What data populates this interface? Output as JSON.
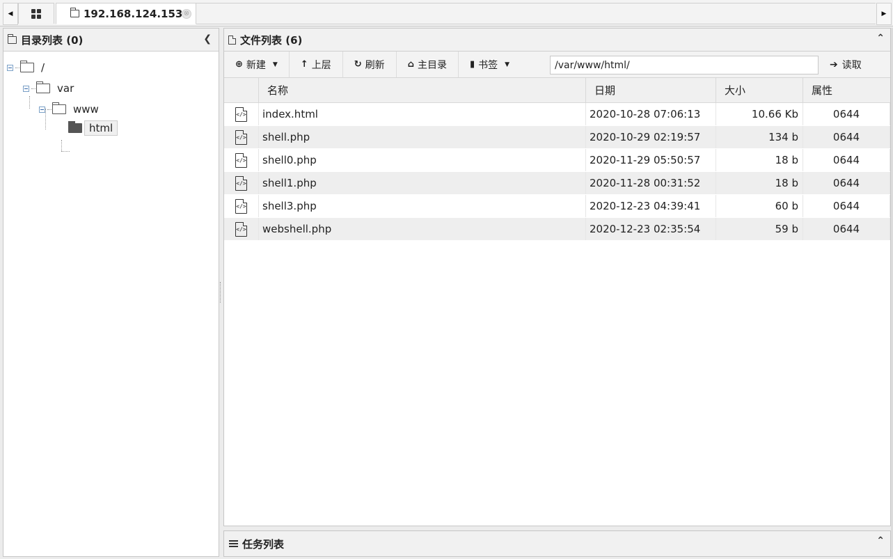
{
  "tabs": {
    "active_label": "192.168.124.153",
    "close_symbol": "⊗",
    "scroll_left": "◀",
    "scroll_right": "▶"
  },
  "left_panel": {
    "title": "目录列表 (0)",
    "collapse_symbol": "❮",
    "tree": [
      {
        "label": "/",
        "state": "expanded"
      },
      {
        "label": "var",
        "state": "expanded"
      },
      {
        "label": "www",
        "state": "expanded"
      },
      {
        "label": "html",
        "state": "selected"
      }
    ]
  },
  "right_panel": {
    "title": "文件列表 (6)",
    "expand_symbol": "⌃",
    "toolbar": {
      "new_label": "新建",
      "up_label": "上层",
      "refresh_label": "刷新",
      "home_label": "主目录",
      "bookmark_label": "书签",
      "path_value": "/var/www/html/",
      "read_label": "读取"
    },
    "columns": [
      "名称",
      "日期",
      "大小",
      "属性"
    ],
    "files": [
      {
        "name": "index.html",
        "date": "2020-10-28 07:06:13",
        "size": "10.66 Kb",
        "perm": "0644"
      },
      {
        "name": "shell.php",
        "date": "2020-10-29 02:19:57",
        "size": "134 b",
        "perm": "0644"
      },
      {
        "name": "shell0.php",
        "date": "2020-11-29 05:50:57",
        "size": "18 b",
        "perm": "0644"
      },
      {
        "name": "shell1.php",
        "date": "2020-11-28 00:31:52",
        "size": "18 b",
        "perm": "0644"
      },
      {
        "name": "shell3.php",
        "date": "2020-12-23 04:39:41",
        "size": "60 b",
        "perm": "0644"
      },
      {
        "name": "webshell.php",
        "date": "2020-12-23 02:35:54",
        "size": "59 b",
        "perm": "0644"
      }
    ]
  },
  "task_panel": {
    "title": "任务列表",
    "expand_symbol": "⌃"
  },
  "icons": {
    "file_glyph": "</>"
  }
}
